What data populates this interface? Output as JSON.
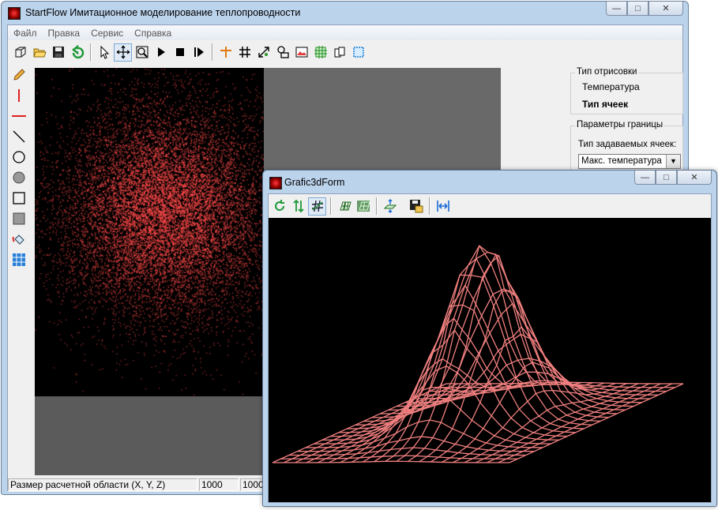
{
  "main_window": {
    "title": "StartFlow  Имитационное моделирование теплопроводности",
    "menu": [
      "Файл",
      "Правка",
      "Сервис",
      "Справка"
    ],
    "toolbar_icons": [
      "new-cube-icon",
      "open-folder-icon",
      "save-icon",
      "undo-icon",
      "pointer-icon",
      "move-icon",
      "zoom-icon",
      "play-icon",
      "stop-icon",
      "step-icon",
      "crosshair-icon",
      "grid-icon",
      "resize-icon",
      "shapes-icon",
      "image-icon",
      "grid-select-icon",
      "copy-icon",
      "select-rect-icon"
    ],
    "left_tools": [
      "pencil-icon",
      "vertical-line-icon",
      "horizontal-line-icon",
      "diagonal-line-icon",
      "circle-icon",
      "filled-circle-icon",
      "rectangle-icon",
      "filled-rectangle-icon",
      "fill-icon",
      "cell-grid-icon"
    ],
    "render_group": {
      "title": "Тип отрисовки",
      "option_temperature": "Температура",
      "option_cell_type": "Тип ячеек"
    },
    "boundary_group": {
      "title": "Параметры границы",
      "cell_type_label": "Тип задаваемых ячеек:",
      "cell_type_value": "Макс. температура"
    },
    "status": {
      "label": "Размер расчетной области (X, Y, Z)",
      "x": "1000",
      "y": "1000"
    },
    "colors": {
      "heat": "#ff4a4a",
      "canvas_bg": "#000000",
      "gray": "#5b5b5b"
    }
  },
  "form3d": {
    "title": "Grafic3dForm",
    "toolbar_icons": [
      "refresh-icon",
      "sort-vertical-icon",
      "grid-hash-icon",
      "wire-grid-icon",
      "solid-grid-icon",
      "surface-arrows-icon",
      "save-image-icon",
      "horizontal-fit-icon"
    ],
    "mesh_color": "#f07f7f"
  }
}
